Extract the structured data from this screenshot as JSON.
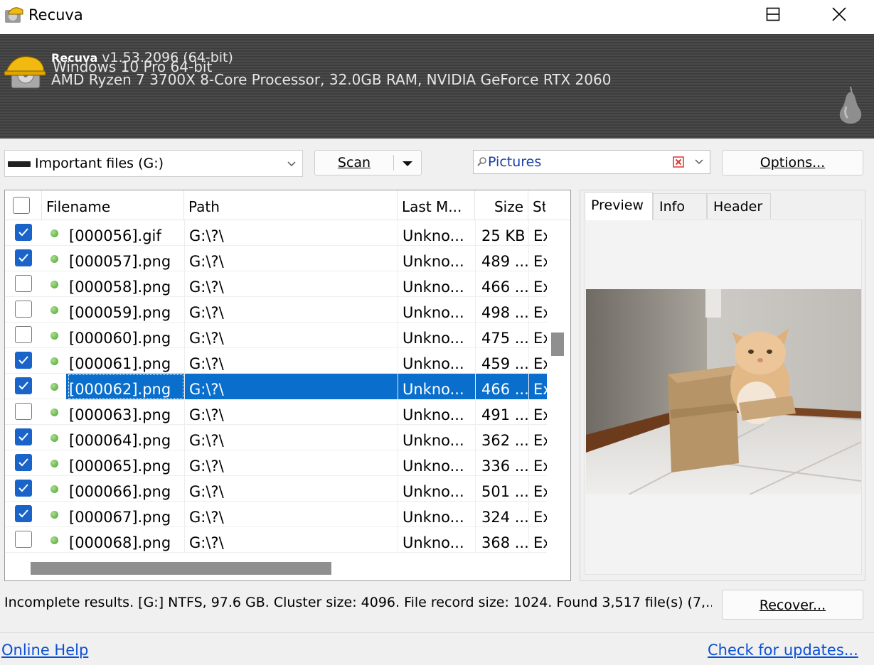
{
  "window": {
    "title": "Recuva",
    "controls": {
      "minimize": "minimize",
      "maximize": "maximize",
      "close": "close"
    }
  },
  "banner": {
    "app_name": "Recuva",
    "version": "v1.53.2096 (64-bit)",
    "os": "Windows 10 Pro 64-bit",
    "hardware": "AMD Ryzen 7 3700X 8-Core Processor, 32.0GB RAM, NVIDIA GeForce RTX 2060"
  },
  "toolbar": {
    "drive_selected": "Important files (G:)",
    "scan_label": "Scan",
    "filter_value": "Pictures",
    "options_label": "Options..."
  },
  "file_list": {
    "columns": {
      "filename": "Filename",
      "path": "Path",
      "last_modified": "Last M...",
      "size": "Size",
      "state": "St"
    },
    "rows": [
      {
        "checked": true,
        "filename": "[000056].gif",
        "path": "G:\\?\\",
        "last_modified": "Unkno...",
        "size": "25 KB",
        "state": "Ex",
        "selected": false
      },
      {
        "checked": true,
        "filename": "[000057].png",
        "path": "G:\\?\\",
        "last_modified": "Unkno...",
        "size": "489 ...",
        "state": "Ex",
        "selected": false
      },
      {
        "checked": false,
        "filename": "[000058].png",
        "path": "G:\\?\\",
        "last_modified": "Unkno...",
        "size": "466 ...",
        "state": "Ex",
        "selected": false
      },
      {
        "checked": false,
        "filename": "[000059].png",
        "path": "G:\\?\\",
        "last_modified": "Unkno...",
        "size": "498 ...",
        "state": "Ex",
        "selected": false
      },
      {
        "checked": false,
        "filename": "[000060].png",
        "path": "G:\\?\\",
        "last_modified": "Unkno...",
        "size": "475 ...",
        "state": "Ex",
        "selected": false
      },
      {
        "checked": true,
        "filename": "[000061].png",
        "path": "G:\\?\\",
        "last_modified": "Unkno...",
        "size": "459 ...",
        "state": "Ex",
        "selected": false
      },
      {
        "checked": true,
        "filename": "[000062].png",
        "path": "G:\\?\\",
        "last_modified": "Unkno...",
        "size": "466 ...",
        "state": "Ex",
        "selected": true
      },
      {
        "checked": false,
        "filename": "[000063].png",
        "path": "G:\\?\\",
        "last_modified": "Unkno...",
        "size": "491 ...",
        "state": "Ex",
        "selected": false
      },
      {
        "checked": true,
        "filename": "[000064].png",
        "path": "G:\\?\\",
        "last_modified": "Unkno...",
        "size": "362 ...",
        "state": "Ex",
        "selected": false
      },
      {
        "checked": true,
        "filename": "[000065].png",
        "path": "G:\\?\\",
        "last_modified": "Unkno...",
        "size": "336 ...",
        "state": "Ex",
        "selected": false
      },
      {
        "checked": true,
        "filename": "[000066].png",
        "path": "G:\\?\\",
        "last_modified": "Unkno...",
        "size": "501 ...",
        "state": "Ex",
        "selected": false
      },
      {
        "checked": true,
        "filename": "[000067].png",
        "path": "G:\\?\\",
        "last_modified": "Unkno...",
        "size": "324 ...",
        "state": "Ex",
        "selected": false
      },
      {
        "checked": false,
        "filename": "[000068].png",
        "path": "G:\\?\\",
        "last_modified": "Unkno...",
        "size": "368 ...",
        "state": "Ex",
        "selected": false
      }
    ]
  },
  "side_panel": {
    "tabs": [
      "Preview",
      "Info",
      "Header"
    ],
    "active_tab": "Preview"
  },
  "status": {
    "text": "Incomplete results. [G:] NTFS, 97.6 GB. Cluster size: 4096. File record size: 1024. Found 3,517 file(s) (7,..."
  },
  "actions": {
    "recover_label": "Recover..."
  },
  "footer": {
    "online_help": "Online Help",
    "check_updates": "Check for updates..."
  },
  "colors": {
    "selection": "#0a6fcc",
    "checkbox_checked": "#1a63c8",
    "link": "#0b4fd4",
    "status_dot": "#4da032"
  }
}
